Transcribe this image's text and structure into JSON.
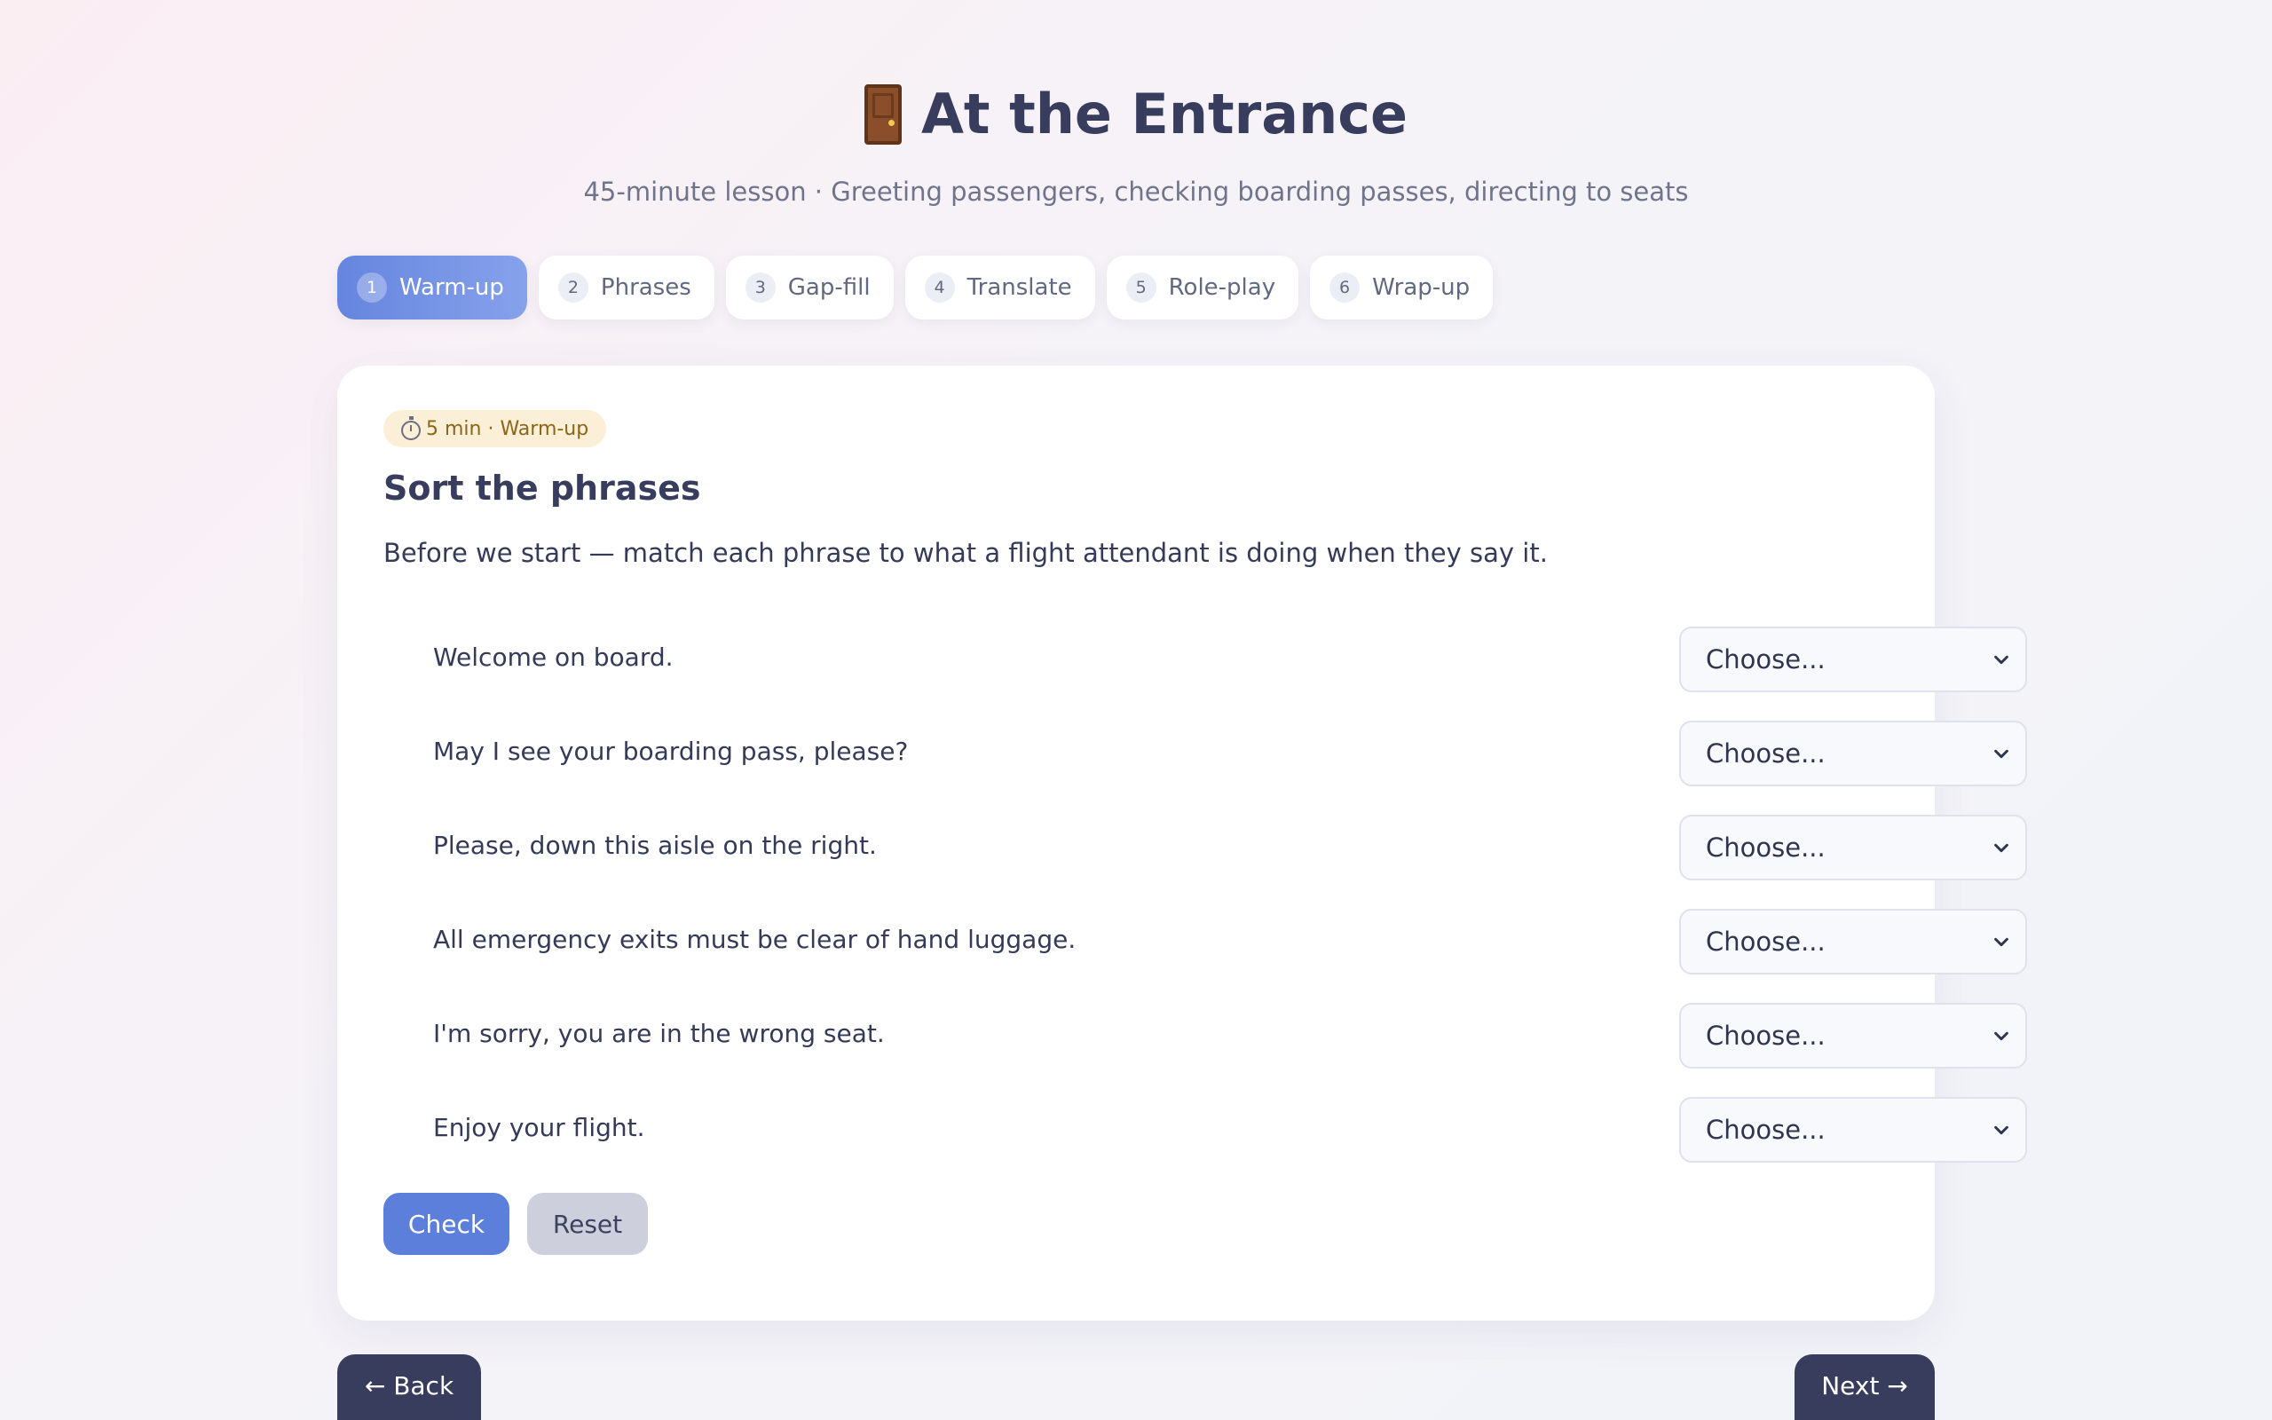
{
  "header": {
    "title": "At the Entrance",
    "title_icon": "door-icon",
    "subtitle": "45-minute lesson · Greeting passengers, checking boarding passes, directing to seats"
  },
  "tabs": [
    {
      "num": "1",
      "label": "Warm-up",
      "active": true
    },
    {
      "num": "2",
      "label": "Phrases",
      "active": false
    },
    {
      "num": "3",
      "label": "Gap-fill",
      "active": false
    },
    {
      "num": "4",
      "label": "Translate",
      "active": false
    },
    {
      "num": "5",
      "label": "Role-play",
      "active": false
    },
    {
      "num": "6",
      "label": "Wrap-up",
      "active": false
    }
  ],
  "card": {
    "badge": "5 min · Warm-up",
    "badge_icon": "stopwatch-icon",
    "title": "Sort the phrases",
    "instructions": "Before we start — match each phrase to what a flight attendant is doing when they say it.",
    "rows": [
      {
        "phrase": "Welcome on board.",
        "selected": "Choose..."
      },
      {
        "phrase": "May I see your boarding pass, please?",
        "selected": "Choose..."
      },
      {
        "phrase": "Please, down this aisle on the right.",
        "selected": "Choose..."
      },
      {
        "phrase": "All emergency exits must be clear of hand luggage.",
        "selected": "Choose..."
      },
      {
        "phrase": "I'm sorry, you are in the wrong seat.",
        "selected": "Choose..."
      },
      {
        "phrase": "Enjoy your flight.",
        "selected": "Choose..."
      }
    ],
    "check_label": "Check",
    "reset_label": "Reset"
  },
  "nav": {
    "back_label": "← Back",
    "next_label": "Next →"
  },
  "colors": {
    "accent": "#5c7fdb",
    "dark": "#383d5e",
    "badge_bg": "#fbefd7",
    "badge_text": "#8a6616"
  }
}
